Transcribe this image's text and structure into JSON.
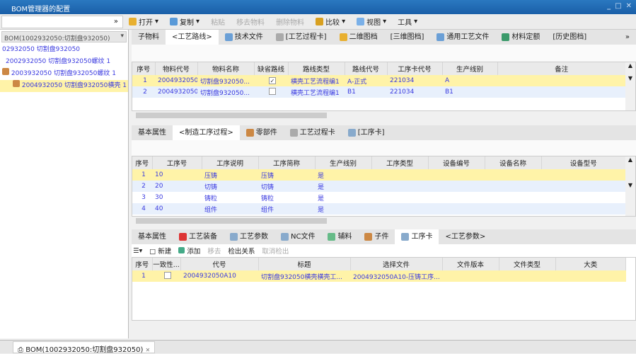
{
  "title": "BOM管理器的配置",
  "window_buttons": [
    "_",
    "□",
    "✕"
  ],
  "toolbar": {
    "search_arrow": "»",
    "open": "打开",
    "copy": "复制",
    "paste": "粘贴",
    "remove": "移去物料",
    "delete": "删除物料",
    "compare": "比较",
    "view": "视图",
    "tools": "工具"
  },
  "left": {
    "dropdown": "BOM(1002932050:切割盘932050)",
    "tree": [
      "02932050 切割盘932050",
      "2002932050 切割盘932050螺纹 1",
      "2003932050 切割盘932050螺纹 1",
      "2004932050 切割盘932050横壳 1"
    ]
  },
  "tabs1": [
    "子物料",
    "<工艺路线>",
    "技术文件",
    "[工艺过程卡]",
    "二维图档",
    "[三维图档]",
    "通用工艺文件",
    "材料定额",
    "[历史图档]"
  ],
  "tabs_more": "»",
  "route_table": {
    "headers": [
      "序号",
      "物料代号",
      "物料名称",
      "缺省路线",
      "路线类型",
      "路线代号",
      "工序卡代号",
      "生产线别",
      "备注"
    ],
    "rows": [
      [
        "1",
        "2004932050",
        "切割盘932050...",
        "✓",
        "横壳工艺流程编1",
        "A-正式",
        "221034",
        "A",
        ""
      ],
      [
        "2",
        "2004932050",
        "切割盘932050...",
        "",
        "横壳工艺流程编1",
        "B1",
        "221034",
        "B1",
        ""
      ]
    ]
  },
  "tabs2": [
    "基本属性",
    "<制造工序过程>",
    "零部件",
    "工艺过程卡",
    "[工序卡]"
  ],
  "op_table": {
    "headers": [
      "序号",
      "工序号",
      "工序说明",
      "工序简称",
      "生产线别",
      "工序类型",
      "设备编号",
      "设备名称",
      "设备型号"
    ],
    "rows": [
      [
        "1",
        "10",
        "压铸",
        "压铸",
        "是",
        "",
        "",
        "",
        ""
      ],
      [
        "2",
        "20",
        "切铸",
        "切铸",
        "是",
        "",
        "",
        "",
        ""
      ],
      [
        "3",
        "30",
        "铸粒",
        "铸粒",
        "是",
        "",
        "",
        "",
        ""
      ],
      [
        "4",
        "40",
        "组件",
        "组件",
        "是",
        "",
        "",
        "",
        ""
      ]
    ]
  },
  "tabs3": [
    "基本属性",
    "工艺装备",
    "工艺参数",
    "NC文件",
    "辅料",
    "子件",
    "工序卡",
    "<工艺参数>"
  ],
  "subtoolbar": {
    "new": "新建",
    "add": "添加",
    "remove": "移去",
    "detect": "检出关系",
    "cancel": "取消检出"
  },
  "card_table": {
    "headers": [
      "序号",
      "一致性...",
      "代号",
      "标题",
      "选择文件",
      "文件版本",
      "文件类型",
      "大类"
    ],
    "rows": [
      [
        "1",
        "",
        "2004932050A10",
        "切割盘932050横壳横壳工...",
        "2004932050A10-压铸工序...",
        "",
        "",
        ""
      ]
    ]
  },
  "status_tab": "BOM(1002932050:切割盘932050)",
  "status_close": "✕"
}
